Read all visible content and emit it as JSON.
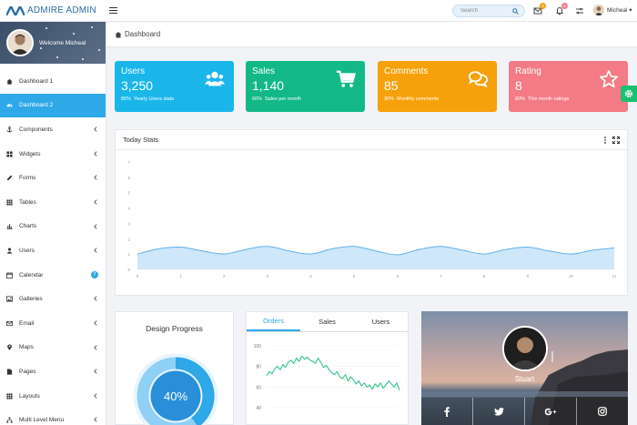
{
  "brand": {
    "name": "ADMIRE ADMIN"
  },
  "search": {
    "placeholder": "Search"
  },
  "header": {
    "mail_badge": "3",
    "bell_badge": "6",
    "user_name": "Micheal ▾"
  },
  "sidebar": {
    "welcome": "Welcome Micheal",
    "items": [
      {
        "label": "Dashboard 1",
        "icon": "home-icon"
      },
      {
        "label": "Dashboard 2",
        "icon": "dashboard-icon"
      },
      {
        "label": "Components",
        "icon": "anchor-icon"
      },
      {
        "label": "Widgets",
        "icon": "grid-icon"
      },
      {
        "label": "Forms",
        "icon": "pencil-icon"
      },
      {
        "label": "Tables",
        "icon": "table-icon"
      },
      {
        "label": "Charts",
        "icon": "bar-chart-icon"
      },
      {
        "label": "Users",
        "icon": "user-icon"
      },
      {
        "label": "Calendar",
        "icon": "calendar-icon",
        "badge": "7"
      },
      {
        "label": "Galleries",
        "icon": "image-icon"
      },
      {
        "label": "Email",
        "icon": "envelope-icon"
      },
      {
        "label": "Maps",
        "icon": "map-marker-icon"
      },
      {
        "label": "Pages",
        "icon": "file-icon"
      },
      {
        "label": "Layouts",
        "icon": "layout-icon"
      },
      {
        "label": "Multi Level Menu",
        "icon": "sitemap-icon"
      }
    ]
  },
  "breadcrumb": {
    "label": "Dashboard"
  },
  "cards": [
    {
      "title": "Users",
      "value": "3,250",
      "percent": "85%",
      "caption": "Yearly Users stats",
      "color": "#1ab6ea",
      "icon": "users-icon"
    },
    {
      "title": "Sales",
      "value": "1,140",
      "percent": "60%",
      "caption": "Sales per month",
      "color": "#12b886",
      "icon": "cart-icon"
    },
    {
      "title": "Comments",
      "value": "85",
      "percent": "30%",
      "caption": "Monthly comments",
      "color": "#f6a10c",
      "icon": "comments-icon"
    },
    {
      "title": "Rating",
      "value": "8",
      "percent": "80%",
      "caption": "This month ratings",
      "color": "#f27b86",
      "icon": "star-icon"
    }
  ],
  "today_stats": {
    "title": "Today Stats",
    "y_ticks": [
      "0",
      "1",
      "2",
      "3",
      "4",
      "5",
      "6",
      "7"
    ],
    "x_ticks": [
      "0",
      "1",
      "2",
      "3",
      "4",
      "5",
      "6",
      "7",
      "8",
      "9",
      "10",
      "11"
    ]
  },
  "design_progress": {
    "title": "Design Progress",
    "value": "40%",
    "fraction": 0.4
  },
  "orders_tabs": {
    "tabs": [
      "Orders",
      "Sales",
      "Users"
    ],
    "active": "Orders",
    "y_ticks": [
      "100",
      "80",
      "60",
      "40"
    ]
  },
  "profile_card": {
    "name": "Stuart"
  },
  "colors": {
    "accent": "#2fa8e8",
    "gear": "#1dbf73"
  },
  "chart_data": [
    {
      "type": "area",
      "title": "Today Stats",
      "x": [
        0,
        0.5,
        1,
        1.5,
        2,
        2.5,
        3,
        3.5,
        4,
        4.5,
        5,
        5.5,
        6,
        6.5,
        7,
        7.5,
        8,
        8.5,
        9,
        9.5,
        10,
        10.5,
        11
      ],
      "y": [
        1.0,
        1.35,
        1.45,
        1.2,
        1.0,
        1.3,
        1.5,
        1.2,
        1.0,
        1.35,
        1.5,
        1.2,
        0.95,
        1.3,
        1.5,
        1.25,
        1.0,
        1.3,
        1.45,
        1.2,
        1.0,
        1.25,
        1.4
      ],
      "xlim": [
        0,
        11
      ],
      "ylim": [
        0,
        7
      ]
    },
    {
      "type": "line",
      "title": "Orders",
      "x": [
        0,
        1,
        2,
        3,
        4,
        5,
        6,
        7,
        8,
        9,
        10,
        11,
        12,
        13,
        14,
        15,
        16,
        17,
        18,
        19,
        20,
        21,
        22,
        23,
        24,
        25,
        26,
        27,
        28,
        29,
        30,
        31,
        32,
        33,
        34,
        35,
        36,
        37,
        38,
        39,
        40,
        41,
        42,
        43,
        44,
        45,
        46,
        47,
        48,
        49
      ],
      "y": [
        71,
        75,
        73,
        78,
        80,
        77,
        82,
        79,
        84,
        86,
        83,
        88,
        85,
        90,
        87,
        89,
        86,
        85,
        83,
        88,
        84,
        79,
        81,
        77,
        74,
        72,
        75,
        70,
        68,
        72,
        66,
        70,
        67,
        63,
        66,
        61,
        64,
        60,
        62,
        58,
        63,
        60,
        64,
        59,
        62,
        66,
        63,
        60,
        64,
        57
      ],
      "ylim": [
        40,
        100
      ]
    }
  ]
}
